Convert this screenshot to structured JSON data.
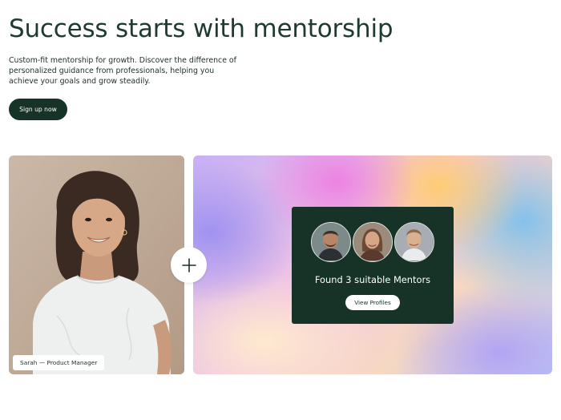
{
  "hero": {
    "title": "Success starts with mentorship",
    "description": "Custom-fit mentorship for growth. Discover the difference of personalized guidance from professionals, helping you achieve your goals and grow steadily.",
    "cta_label": "Sign up now"
  },
  "portrait": {
    "caption": "Sarah — Product Manager"
  },
  "connector": {
    "icon": "plus-icon"
  },
  "mentor_panel": {
    "avatars": [
      {
        "icon": "mentor-avatar"
      },
      {
        "icon": "mentor-avatar"
      },
      {
        "icon": "mentor-avatar"
      }
    ],
    "result_text": "Found 3 suitable Mentors",
    "button_label": "View Profiles"
  },
  "colors": {
    "brand_dark": "#173226",
    "title_color": "#1f3b30"
  }
}
